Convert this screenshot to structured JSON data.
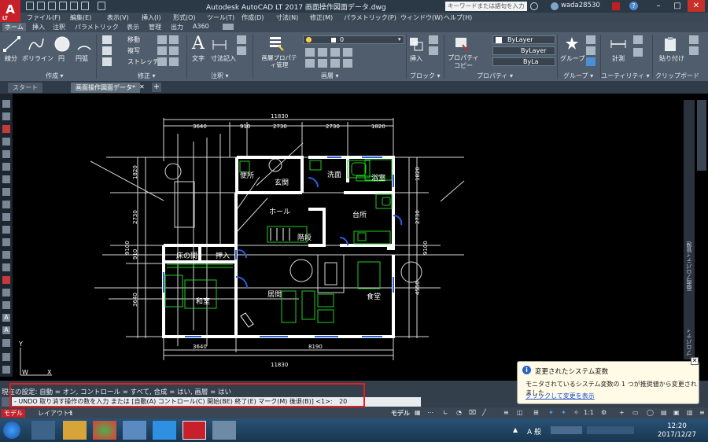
{
  "title_bar": {
    "logo_text": "A",
    "logo_sub": "LT",
    "title": "Autodesk AutoCAD LT 2017    画面操作図面データ.dwg",
    "search_placeholder": "キーワードまたは語句を入力",
    "user": "wada28530"
  },
  "menu": [
    "ファイル(F)",
    "編集(E)",
    "表示(V)",
    "挿入(I)",
    "形式(O)",
    "ツール(T)",
    "作成(D)",
    "寸法(N)",
    "修正(M)",
    "パラメトリック(P)",
    "ウィンドウ(W)",
    "ヘルプ(H)"
  ],
  "ribbon_tabs": [
    "ホーム",
    "挿入",
    "注釈",
    "パラメトリック",
    "表示",
    "管理",
    "出力",
    "A360"
  ],
  "ribbon": {
    "draw": {
      "line": "線分",
      "polyline": "ポリライン",
      "circle": "円",
      "arc": "円弧",
      "panel": "作成 ▾"
    },
    "modify": {
      "move": "移動",
      "copy": "複写",
      "stretch": "ストレッチ",
      "panel": "修正 ▾"
    },
    "annotation": {
      "text": "文字",
      "dim": "寸法記入",
      "panel": "注釈 ▾"
    },
    "layers": {
      "layer_props": "画層プロパティ管理",
      "current": "0",
      "panel": "画層 ▾"
    },
    "block": {
      "insert": "挿入",
      "panel": "ブロック ▾"
    },
    "properties": {
      "match": "プロパティコピー",
      "bylayer1": "ByLayer",
      "bylayer2": "ByLayer",
      "bylayer3": "ByLa",
      "panel": "プロパティ ▾"
    },
    "groups": {
      "group": "グループ",
      "panel": "グループ ▾"
    },
    "utilities": {
      "measure": "計測",
      "panel": "ユーティリティ ▾"
    },
    "clipboard": {
      "paste": "貼り付け",
      "panel": "クリップボード"
    }
  },
  "doc_tabs": [
    "スタート",
    "画面操作図面データ*"
  ],
  "drawing": {
    "rooms": [
      "便所",
      "玄関",
      "洗面",
      "浴室",
      "ホール",
      "台所",
      "階段",
      "床の間",
      "押入",
      "和室",
      "居間",
      "食堂"
    ],
    "dims_top": [
      "11830",
      "3640",
      "910",
      "2730",
      "2730",
      "1820"
    ],
    "dims_bottom": [
      "3640",
      "8190",
      "11830"
    ],
    "dims_left": [
      "1820",
      "2730",
      "910",
      "9100",
      "3640"
    ],
    "dims_right": [
      "1820",
      "2730",
      "9100",
      "4550"
    ],
    "axis_y": "Y",
    "axis_x": "X",
    "axis_w": "W"
  },
  "right_strip": {
    "text1": "画面プロパティ管理",
    "text2": "プロパティ"
  },
  "command": {
    "history": "現在の設定: 自動 = オン, コントロール = すべて, 合成 = はい, 画層 = はい",
    "prompt": "- UNDO 取り消す操作の数を入力 または [自動(A) コントロール(C) 開始(BE) 終了(E) マーク(M) 後退(B)] <1>:",
    "value": "20"
  },
  "status": {
    "model": "モデル",
    "scale": "1:1"
  },
  "layout_tabs": [
    "モデル",
    "レイアウト1"
  ],
  "notification": {
    "title": "変更されたシステム変数",
    "body": "モニタされているシステム変数の 1 つが推奨値から変更されました",
    "link": "クリックして変更を表示"
  },
  "taskbar": {
    "ime": "A 般",
    "time": "12:20",
    "date": "2017/12/27"
  },
  "colors": {
    "accent": "#c8202a",
    "wall": "#ffffff",
    "fixture": "#22cc22",
    "door": "#2a5fd6",
    "highlight": "#e02020"
  }
}
